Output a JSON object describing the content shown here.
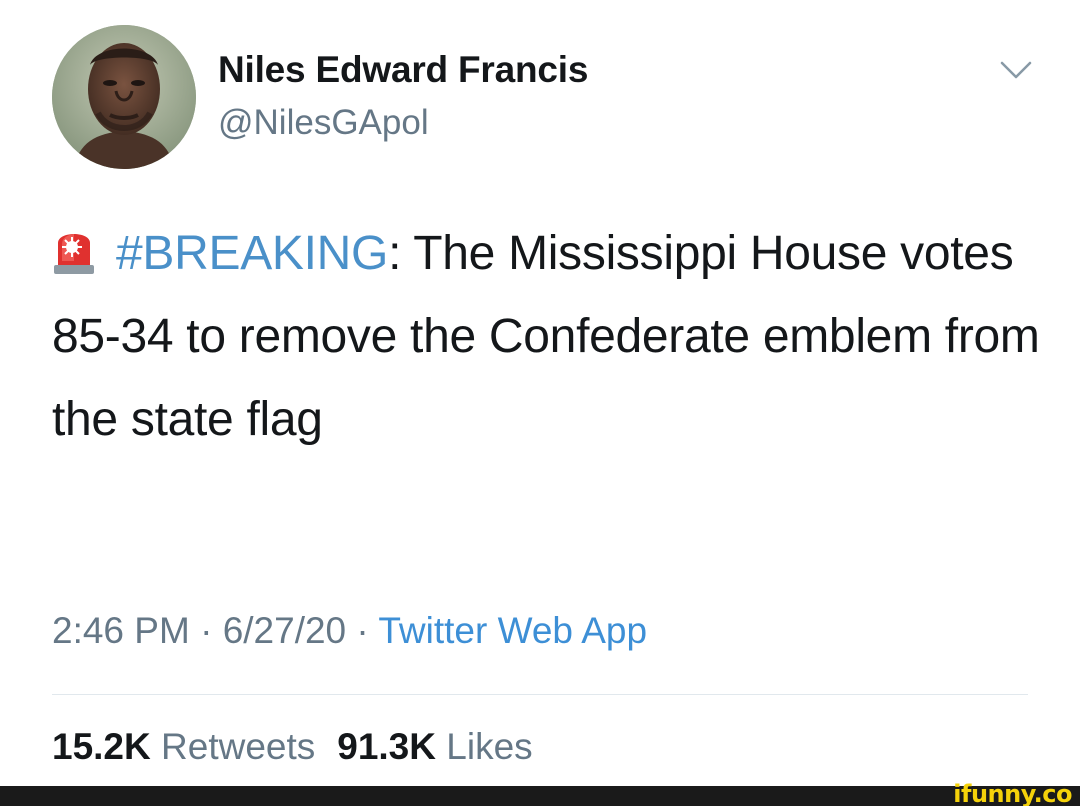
{
  "author": {
    "display_name": "Niles Edward Francis",
    "handle": "@NilesGApol"
  },
  "tweet": {
    "emoji_icon": "police-siren-icon",
    "hashtag": "#BREAKING",
    "text_after_hashtag": ": The Mississippi House votes 85-34 to remove the Confederate emblem from the state flag"
  },
  "meta": {
    "time": "2:46 PM",
    "separator_1": " · ",
    "date": "6/27/20",
    "separator_2": " · ",
    "source": "Twitter Web App"
  },
  "stats": {
    "retweets_count": "15.2K",
    "retweets_label": "Retweets",
    "likes_count": "91.3K",
    "likes_label": "Likes"
  },
  "watermark": {
    "text": "ifunny.co"
  },
  "colors": {
    "link": "#4a90c9",
    "secondary_text": "#657786",
    "watermark": "#f5d20a"
  }
}
